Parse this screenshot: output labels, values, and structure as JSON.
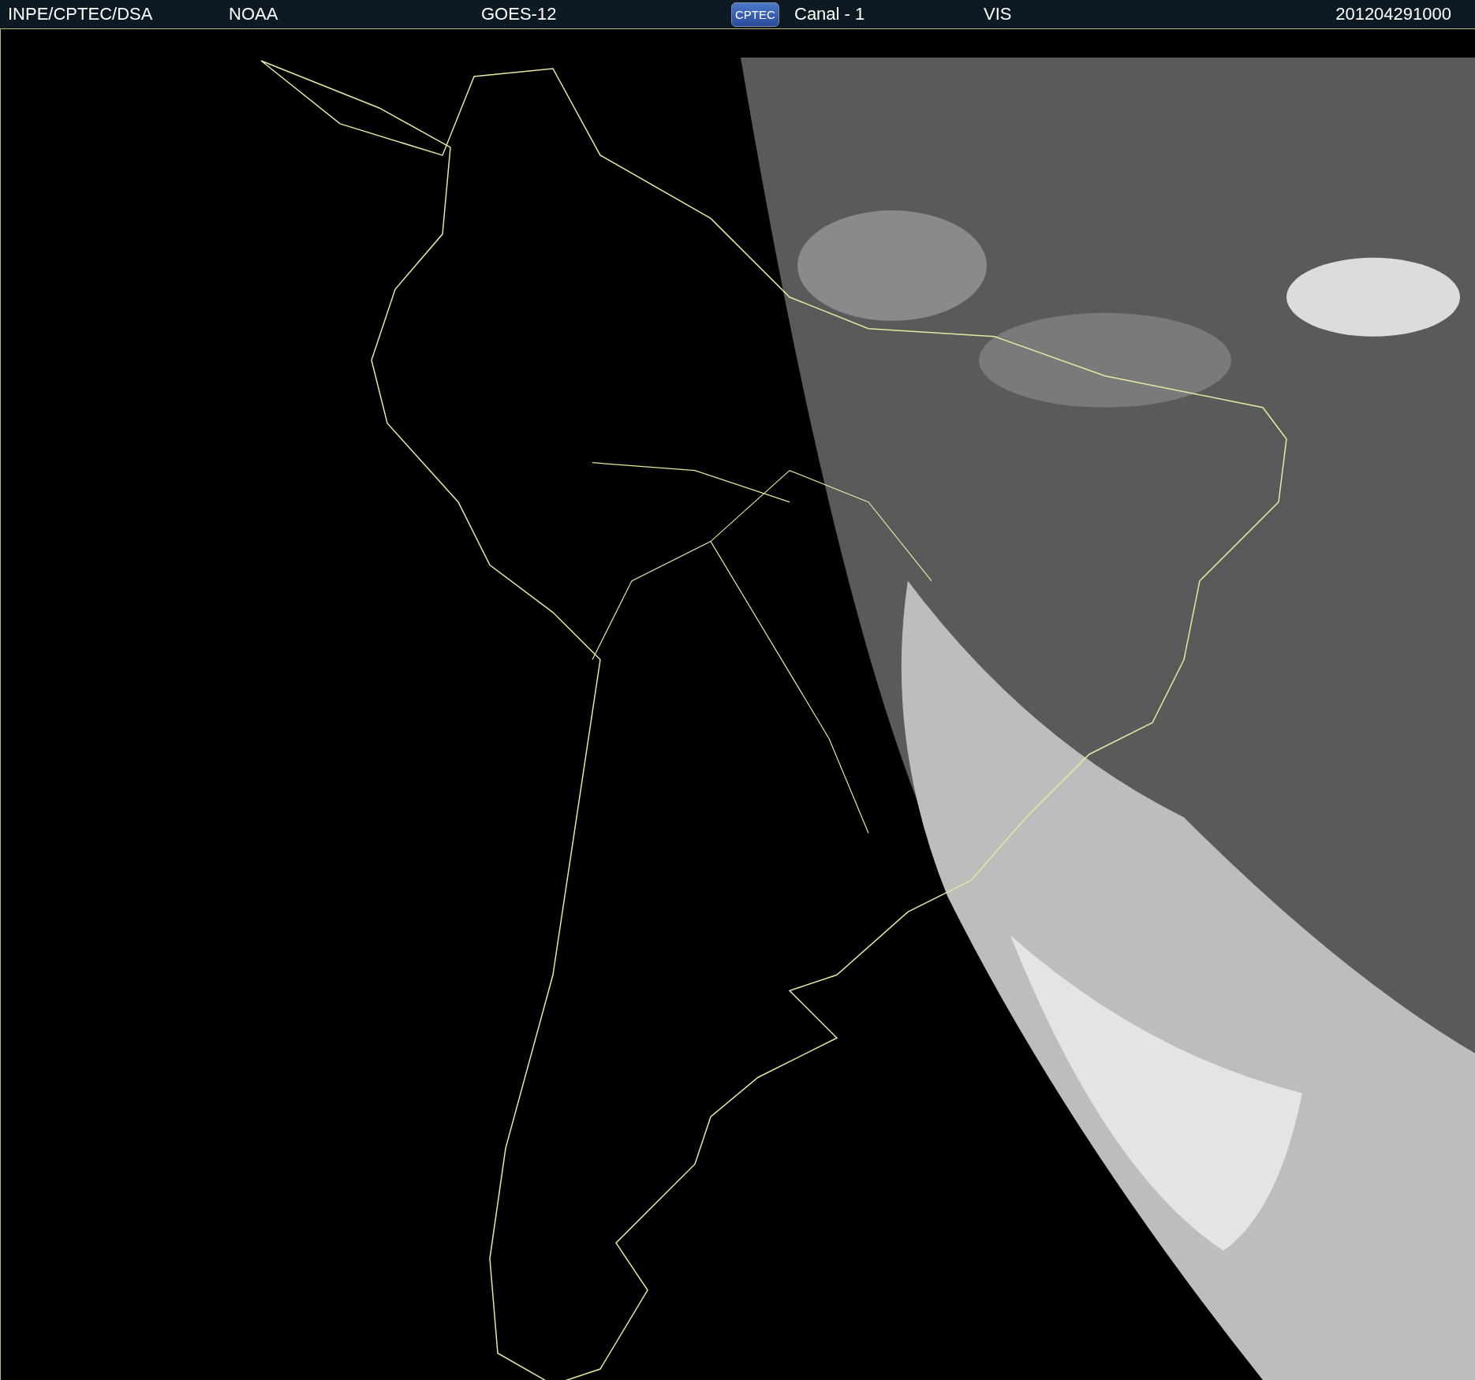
{
  "header": {
    "source": "INPE/CPTEC/DSA",
    "agency": "NOAA",
    "satellite": "GOES-12",
    "logo": "CPTEC",
    "channel": "Canal - 1",
    "band": "VIS",
    "timestamp": "201204291000"
  }
}
